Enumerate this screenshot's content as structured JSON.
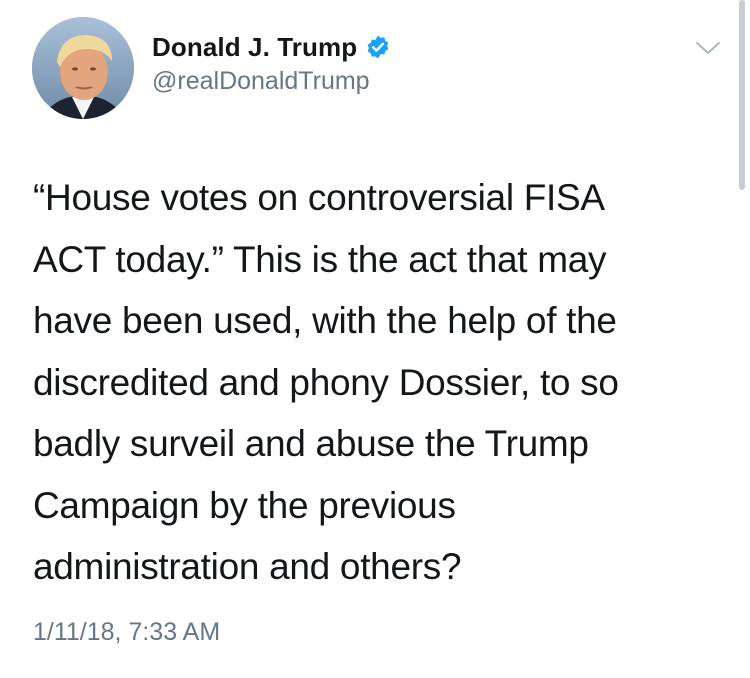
{
  "user": {
    "display_name": "Donald J. Trump",
    "handle": "@realDonaldTrump",
    "verified_icon": "verified-badge-icon"
  },
  "menu": {
    "icon": "chevron-down-icon"
  },
  "tweet": {
    "text": "“House votes on controversial FISA\nACT today.” This is the act that may\nhave been used, with the help of the\ndiscredited and phony Dossier, to so\nbadly surveil and abuse the Trump\nCampaign by the previous\nadministration and others?",
    "timestamp": "1/11/18, 7:33 AM"
  },
  "colors": {
    "text_primary": "#14171a",
    "text_secondary": "#657786",
    "verified_blue": "#1da1f2",
    "background": "#ffffff"
  }
}
